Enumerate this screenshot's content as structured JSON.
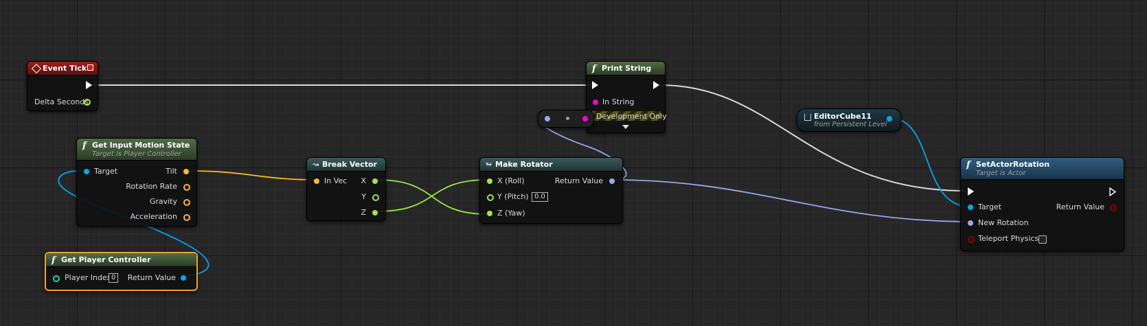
{
  "nodes": {
    "event_tick": {
      "title": "Event Tick",
      "pins": {
        "delta": "Delta Seconds"
      }
    },
    "print_string": {
      "title": "Print String",
      "pins": {
        "in_string": "In String",
        "dev_only": "Development Only"
      }
    },
    "editor_cube": {
      "title": "EditorCube11",
      "subtitle": "from Persistent Level"
    },
    "get_input_motion": {
      "title": "Get Input Motion State",
      "subtitle": "Target is Player Controller",
      "pins": {
        "target": "Target",
        "tilt": "Tilt",
        "rotation_rate": "Rotation Rate",
        "gravity": "Gravity",
        "acceleration": "Acceleration"
      }
    },
    "break_vector": {
      "title": "Break Vector",
      "pins": {
        "in_vec": "In Vec",
        "x": "X",
        "y": "Y",
        "z": "Z"
      }
    },
    "make_rotator": {
      "title": "Make Rotator",
      "pins": {
        "roll": "X (Roll)",
        "pitch": "Y (Pitch)",
        "pitch_value": "0.0",
        "yaw": "Z (Yaw)",
        "return_value": "Return Value"
      }
    },
    "set_actor_rotation": {
      "title": "SetActorRotation",
      "subtitle": "Target is Actor",
      "pins": {
        "target": "Target",
        "return_value": "Return Value",
        "new_rotation": "New Rotation",
        "teleport": "Teleport Physics"
      }
    },
    "get_player_controller": {
      "title": "Get Player Controller",
      "pins": {
        "player_index": "Player Index",
        "player_index_value": "0",
        "return_value": "Return Value"
      }
    }
  },
  "colors": {
    "exec": "#ffffff",
    "object": "#00a8f2",
    "vector": "#fcbb24",
    "float": "#9bea44",
    "rotator": "#9ea6f2",
    "string": "#ff00d4",
    "bool": "#920000"
  }
}
